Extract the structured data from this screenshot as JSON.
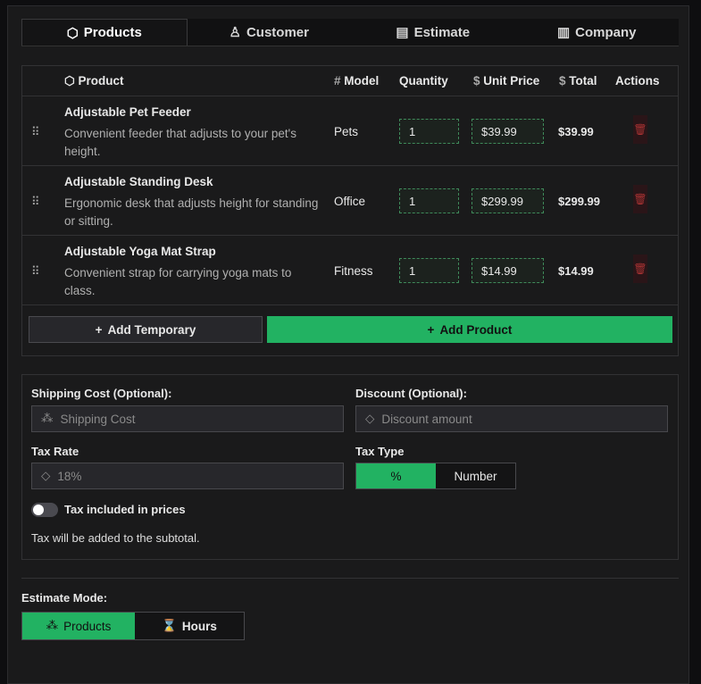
{
  "tabs": [
    {
      "label": "Products",
      "icon": "box-icon"
    },
    {
      "label": "Customer",
      "icon": "user-icon"
    },
    {
      "label": "Estimate",
      "icon": "document-icon"
    },
    {
      "label": "Company",
      "icon": "building-icon"
    }
  ],
  "table": {
    "headers": {
      "product": "Product",
      "model": "Model",
      "quantity": "Quantity",
      "unit_price": "Unit Price",
      "total": "Total",
      "actions": "Actions"
    },
    "rows": [
      {
        "name": "Adjustable Pet Feeder",
        "description": "Convenient feeder that adjusts to your pet's height.",
        "model": "Pets",
        "quantity": "1",
        "unit_price": "$39.99",
        "total": "$39.99"
      },
      {
        "name": "Adjustable Standing Desk",
        "description": "Ergonomic desk that adjusts height for standing or sitting.",
        "model": "Office",
        "quantity": "1",
        "unit_price": "$299.99",
        "total": "$299.99"
      },
      {
        "name": "Adjustable Yoga Mat Strap",
        "description": "Convenient strap for carrying yoga mats to class.",
        "model": "Fitness",
        "quantity": "1",
        "unit_price": "$14.99",
        "total": "$14.99"
      }
    ]
  },
  "buttons": {
    "add_temporary": "Add Temporary",
    "add_product": "Add Product"
  },
  "settings": {
    "shipping_label": "Shipping Cost (Optional):",
    "shipping_placeholder": "Shipping Cost",
    "discount_label": "Discount (Optional):",
    "discount_placeholder": "Discount amount",
    "tax_rate_label": "Tax Rate",
    "tax_rate_placeholder": "18%",
    "tax_type_label": "Tax Type",
    "tax_type_options": [
      "%",
      "Number"
    ],
    "tax_type_selected": "%",
    "tax_included_label": "Tax included in prices",
    "tax_included": false,
    "tax_note": "Tax will be added to the subtotal."
  },
  "estimate_mode": {
    "label": "Estimate Mode:",
    "options": [
      "Products",
      "Hours"
    ],
    "selected": "Products"
  },
  "colors": {
    "accent": "#22b262",
    "danger": "#a33333"
  }
}
